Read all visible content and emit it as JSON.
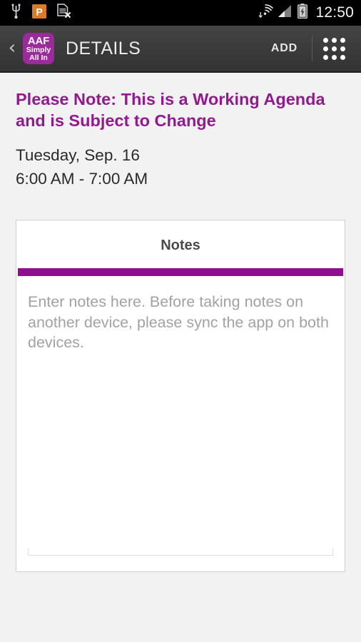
{
  "status_bar": {
    "icons": [
      "usb-icon",
      "app-notification-icon",
      "sim-card-missing-icon",
      "wifi-icon",
      "cellular-signal-icon",
      "battery-charging-icon"
    ],
    "time": "12:50"
  },
  "action_bar": {
    "back_label": "‹",
    "logo": {
      "line1": "AAF",
      "line2": "Simply",
      "line3": "All In"
    },
    "title": "DETAILS",
    "add_label": "ADD",
    "grid_icon": "apps-grid-icon"
  },
  "main": {
    "notice": "Please Note: This is a Working Agenda and is Subject to Change",
    "date": "Tuesday, Sep. 16",
    "time_range": "6:00 AM - 7:00 AM",
    "notes_card": {
      "header": "Notes",
      "placeholder": "Enter notes here. Before taking notes on another device, please sync the app on both devices.",
      "value": ""
    }
  },
  "colors": {
    "brand_purple": "#93198f",
    "rule_purple": "#8e0f8e",
    "logo_purple": "#9b2b9b",
    "action_bar": "#3b3b3b",
    "page_bg": "#f2f2f2"
  }
}
